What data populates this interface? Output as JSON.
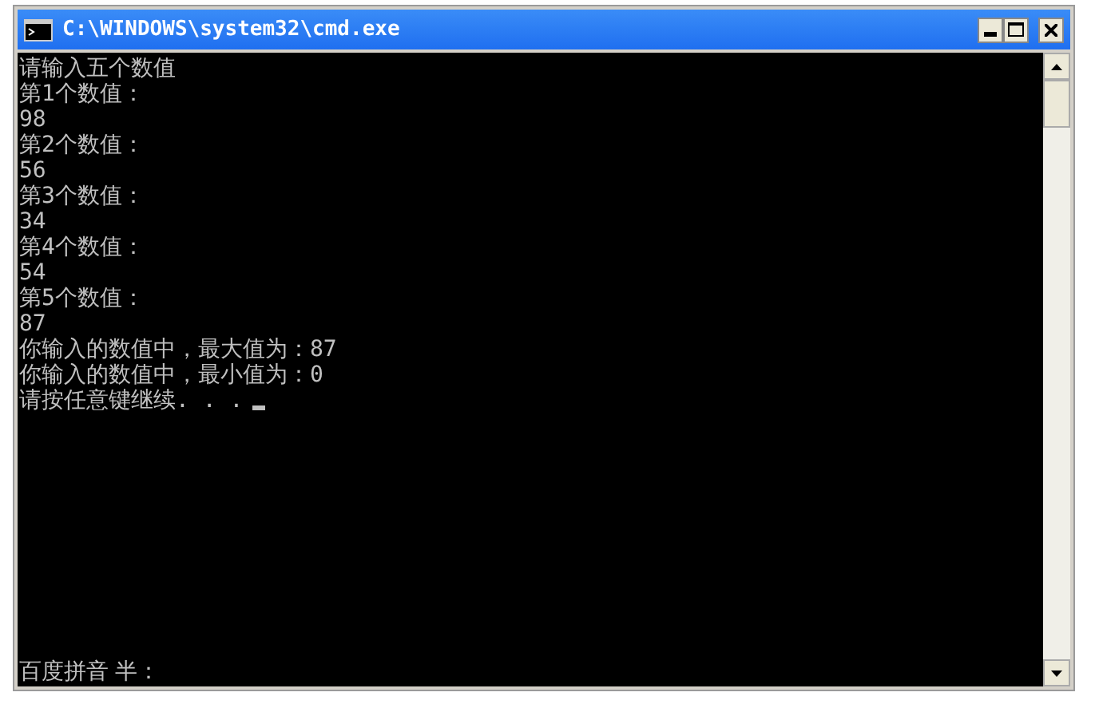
{
  "window": {
    "title": "C:\\WINDOWS\\system32\\cmd.exe"
  },
  "console": {
    "lines": [
      "请输入五个数值",
      "第1个数值：",
      "98",
      "第2个数值：",
      "56",
      "第3个数值：",
      "34",
      "第4个数值：",
      "54",
      "第5个数值：",
      "87",
      "你输入的数值中，最大值为：87",
      "你输入的数值中，最小值为：0",
      "请按任意键继续. . ."
    ],
    "cursor": true
  },
  "ime_bar": {
    "text": "百度拼音 半："
  }
}
